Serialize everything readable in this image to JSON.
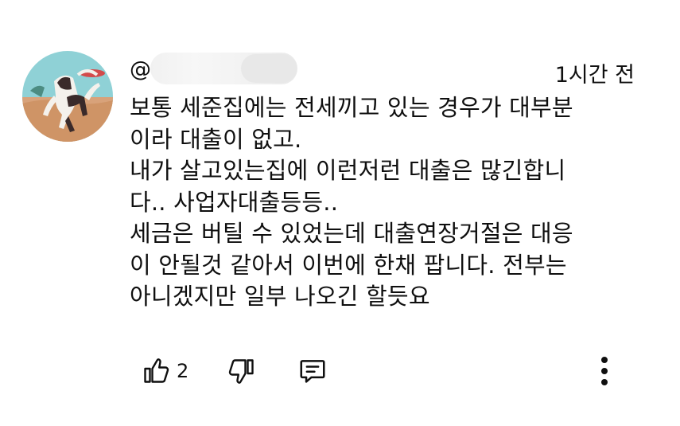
{
  "comment": {
    "author_handle_visible": "@",
    "timestamp": "1시간 전",
    "lines": [
      "보통 세준집에는 전세끼고 있는 경우가 대부분",
      "이라 대출이 없고.",
      "내가 살고있는집에 이런저런 대출은 많긴합니",
      "다.. 사업자대출등등..",
      "세금은 버틸 수 있었는데 대출연장거절은 대응",
      "이 안될것 같아서 이번에 한채 팝니다. 전부는",
      "아니겠지만 일부 나오긴 할듯요"
    ],
    "like_count": "2"
  },
  "icons": {
    "like": "thumbs-up-icon",
    "dislike": "thumbs-down-icon",
    "reply": "reply-comment-icon",
    "more": "more-vertical-icon"
  }
}
